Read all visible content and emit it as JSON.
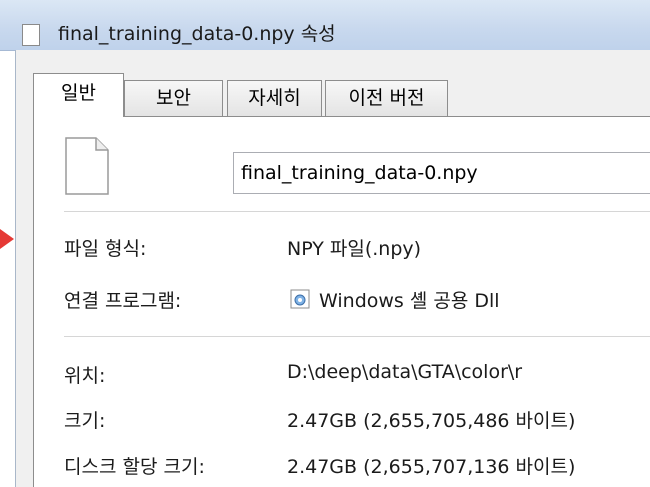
{
  "window": {
    "title": "final_training_data-0.npy 속성"
  },
  "tabs": [
    {
      "label": "일반"
    },
    {
      "label": "보안"
    },
    {
      "label": "자세히"
    },
    {
      "label": "이전 버전"
    }
  ],
  "general": {
    "filename": "final_training_data-0.npy",
    "rows": [
      {
        "label": "파일 형식:",
        "value": "NPY 파일(.npy)"
      },
      {
        "label": "연결 프로그램:",
        "value": "Windows 셸 공용 Dll"
      },
      {
        "label": "위치:",
        "value": "D:\\deep\\data\\GTA\\color\\r"
      },
      {
        "label": "크기:",
        "value": "2.47GB (2,655,705,486 바이트)"
      },
      {
        "label": "디스크 할당 크기:",
        "value": "2.47GB (2,655,707,136 바이트)"
      }
    ]
  },
  "colors": {
    "title_bar": "#c9d9ee",
    "annotation_arrow": "#e53935",
    "dialog_bg": "#f0f0f0"
  },
  "icons": [
    "file-icon",
    "windows-shell-icon",
    "arrow-icon"
  ]
}
